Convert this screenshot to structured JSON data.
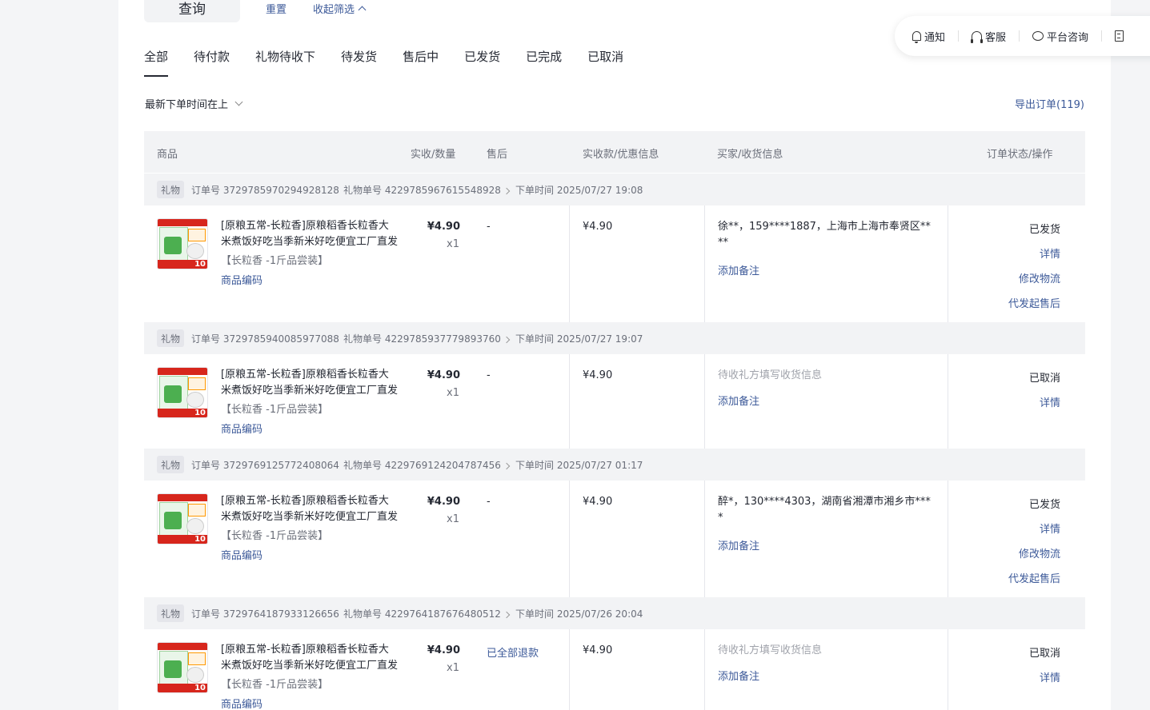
{
  "filters": {
    "query_label": "查询",
    "reset_label": "重置",
    "collapse_label": "收起筛选"
  },
  "tabs": [
    "全部",
    "待付款",
    "礼物待收下",
    "待发货",
    "售后中",
    "已发货",
    "已完成",
    "已取消"
  ],
  "float_bar": {
    "notify": "通知",
    "service": "客服",
    "consult": "平台咨询"
  },
  "sort": {
    "label": "最新下单时间在上"
  },
  "export": {
    "label": "导出订单(119)"
  },
  "table": {
    "columns": {
      "product": "商品",
      "received_qty": "实收/数量",
      "aftersale": "售后",
      "amount": "实收款/优惠信息",
      "buyer": "买家/收货信息",
      "status": "订单状态/操作"
    }
  },
  "orders": [
    {
      "badge": "礼物",
      "order_no": "订单号 3729785970294928128",
      "gift_no": "礼物单号 4229785967615548928",
      "time": "下单时间 2025/07/27 19:08",
      "product_title_1": "[原粮五常-长粒香]原粮稻香长粒香大",
      "product_title_2": "米煮饭好吃当季新米好吃便宜工厂直发",
      "spec": "【长粒香 -1斤品尝装】",
      "code": "商品编码",
      "price": "¥4.90",
      "qty": "x1",
      "aftersale": "-",
      "received": "¥4.90",
      "buyer": "徐**，159****1887，上海市上海市奉贤区****",
      "note": "添加备注",
      "status": "已发货",
      "ops": [
        "详情",
        "修改物流",
        "代发起售后"
      ]
    },
    {
      "badge": "礼物",
      "order_no": "订单号 3729785940085977088",
      "gift_no": "礼物单号 4229785937779893760",
      "time": "下单时间 2025/07/27 19:07",
      "product_title_1": "[原粮五常-长粒香]原粮稻香长粒香大",
      "product_title_2": "米煮饭好吃当季新米好吃便宜工厂直发",
      "spec": "【长粒香 -1斤品尝装】",
      "code": "商品编码",
      "price": "¥4.90",
      "qty": "x1",
      "aftersale": "-",
      "received": "¥4.90",
      "buyer": "待收礼方填写收货信息",
      "note": "添加备注",
      "status": "已取消",
      "ops": [
        "详情"
      ]
    },
    {
      "badge": "礼物",
      "order_no": "订单号 3729769125772408064",
      "gift_no": "礼物单号 4229769124204787456",
      "time": "下单时间 2025/07/27 01:17",
      "product_title_1": "[原粮五常-长粒香]原粮稻香长粒香大",
      "product_title_2": "米煮饭好吃当季新米好吃便宜工厂直发",
      "spec": "【长粒香 -1斤品尝装】",
      "code": "商品编码",
      "price": "¥4.90",
      "qty": "x1",
      "aftersale": "-",
      "received": "¥4.90",
      "buyer": "醉*，130****4303，湖南省湘潭市湘乡市****",
      "note": "添加备注",
      "status": "已发货",
      "ops": [
        "详情",
        "修改物流",
        "代发起售后"
      ]
    },
    {
      "badge": "礼物",
      "order_no": "订单号 3729764187933126656",
      "gift_no": "礼物单号 4229764187676480512",
      "time": "下单时间 2025/07/26 20:04",
      "product_title_1": "[原粮五常-长粒香]原粮稻香长粒香大",
      "product_title_2": "米煮饭好吃当季新米好吃便宜工厂直发",
      "spec": "【长粒香 -1斤品尝装】",
      "code": "商品编码",
      "price": "¥4.90",
      "qty": "x1",
      "aftersale": "已全部退款",
      "received": "¥4.90",
      "buyer": "待收礼方填写收货信息",
      "note": "添加备注",
      "status": "已取消",
      "ops": [
        "详情"
      ]
    }
  ],
  "thumb_text": {
    "badge_num": "10"
  }
}
